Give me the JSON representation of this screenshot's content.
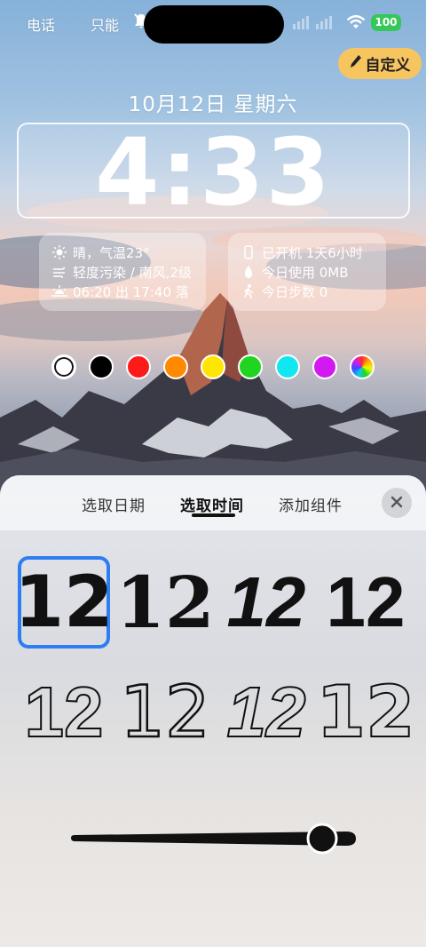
{
  "status_bar": {
    "carrier_1": "电话",
    "carrier_2": "只能",
    "battery": "100"
  },
  "customize_button": {
    "label": "自定义"
  },
  "lockscreen": {
    "date": "10月12日 星期六",
    "time": "4:33"
  },
  "widgets": {
    "weather": "晴，气温23°",
    "air": "轻度污染 / 南风,2级",
    "sun": "06:20 出 17:40 落",
    "uptime": "已开机 1天6小时",
    "usage": "今日使用 0MB",
    "steps": "今日步数 0"
  },
  "swatches": [
    "#ffffff",
    "#000000",
    "#ff1a1a",
    "#ff8a00",
    "#ffe600",
    "#1fd51f",
    "#12e6f0",
    "#d21af0",
    "rainbow"
  ],
  "selected_swatch": 0,
  "tabs": [
    {
      "label": "选取日期"
    },
    {
      "label": "选取时间"
    },
    {
      "label": "添加组件"
    }
  ],
  "active_tab": 1,
  "font_options": [
    "12",
    "12",
    "12",
    "12",
    "12",
    "12",
    "12",
    "12"
  ],
  "selected_font": 0,
  "slider": {
    "value_fraction": 0.89
  }
}
